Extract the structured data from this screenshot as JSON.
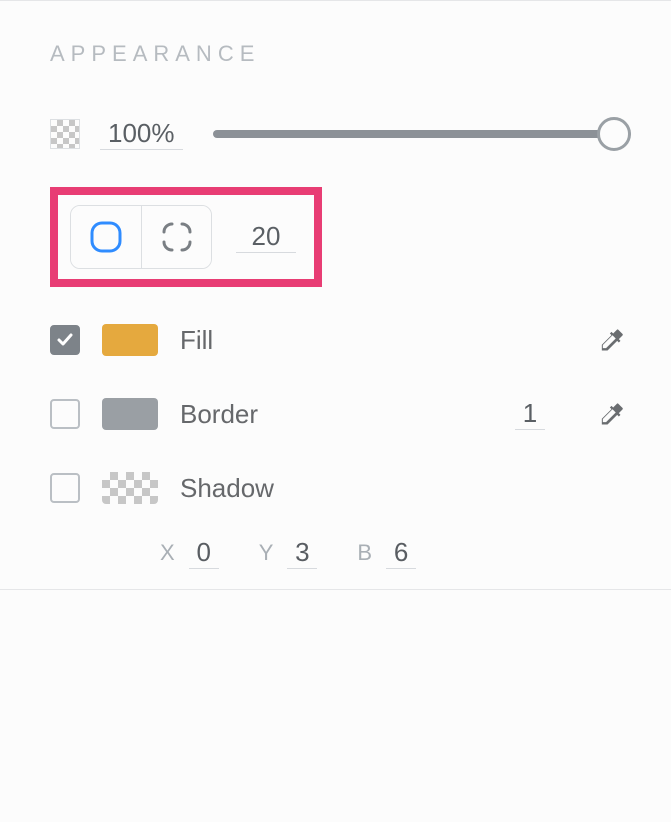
{
  "section": {
    "title": "APPEARANCE"
  },
  "opacity": {
    "value": "100%"
  },
  "cornerRadius": {
    "value": "20"
  },
  "fill": {
    "label": "Fill",
    "checked": true,
    "color": "#e5a93e"
  },
  "border": {
    "label": "Border",
    "checked": false,
    "width": "1",
    "color": "#9a9fa4"
  },
  "shadow": {
    "label": "Shadow",
    "checked": false,
    "x": {
      "label": "X",
      "value": "0"
    },
    "y": {
      "label": "Y",
      "value": "3"
    },
    "b": {
      "label": "B",
      "value": "6"
    }
  }
}
